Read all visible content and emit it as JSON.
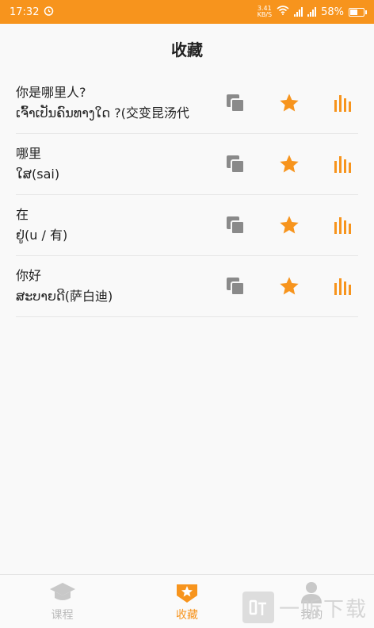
{
  "status": {
    "time": "17:32",
    "net_speed": "3.41",
    "net_unit": "KB/S",
    "battery": "58%"
  },
  "header": {
    "title": "收藏"
  },
  "favorites": [
    {
      "chinese": "你是哪里人?",
      "lao": "ເຈົ້າເປັນຄົນທາງໃດ ?(交变昆汤代"
    },
    {
      "chinese": "哪里",
      "lao": "ໃສ(sai)"
    },
    {
      "chinese": "在",
      "lao": "ຢູ່(u / 有)"
    },
    {
      "chinese": "你好",
      "lao": "ສະບາຍດີ(萨白迪)"
    }
  ],
  "nav": [
    {
      "label": "课程",
      "icon": "graduation-cap-icon"
    },
    {
      "label": "收藏",
      "icon": "star-badge-icon",
      "active": true
    },
    {
      "label": "我的",
      "icon": "person-icon"
    }
  ],
  "watermark": {
    "text": "一听下载"
  },
  "colors": {
    "accent": "#f7941d",
    "icon_gray": "#8a8a8a"
  }
}
